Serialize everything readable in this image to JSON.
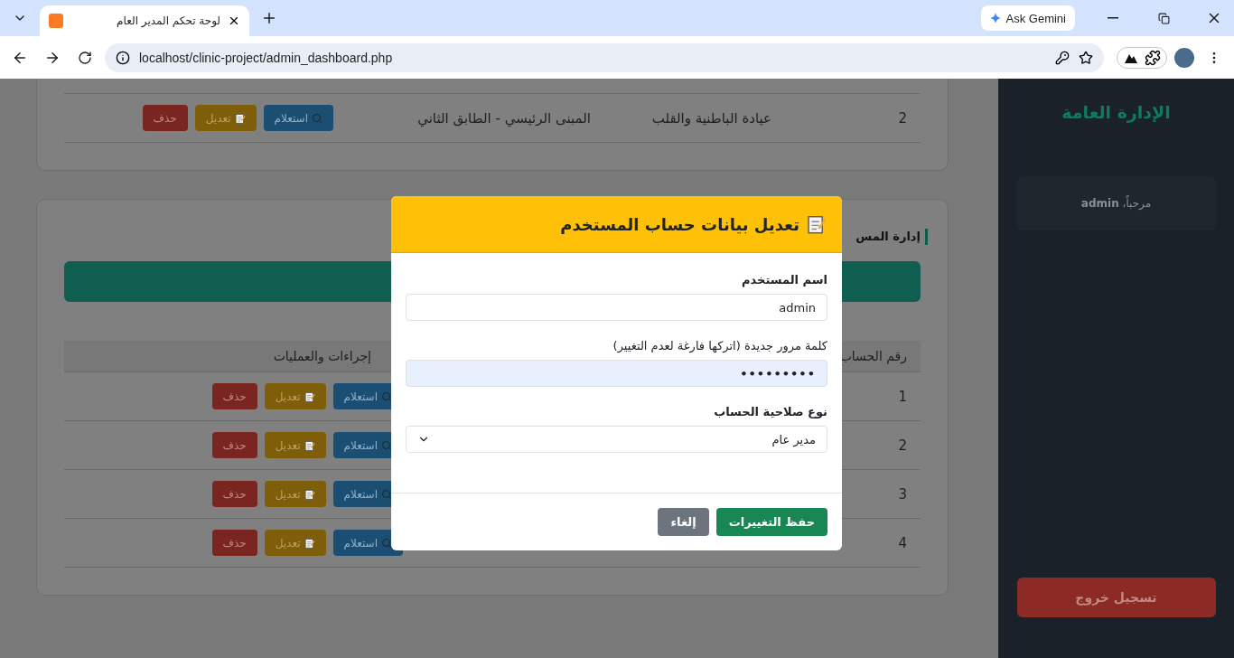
{
  "browser": {
    "tab_title": "لوحة تحكم المدير العام",
    "url": "localhost/clinic-project/admin_dashboard.php",
    "gemini_label": "Ask Gemini"
  },
  "locations_card": {
    "rows": [
      {
        "number": "2",
        "clinic": "عيادة الباطنية والقلب",
        "location": "المبنى الرئيسي - الطابق الثاني",
        "actions": [
          {
            "kind": "inquire",
            "label": "استعلام"
          },
          {
            "kind": "edit",
            "label": "تعديل"
          },
          {
            "kind": "delete",
            "label": "حذف"
          }
        ]
      }
    ]
  },
  "users_card": {
    "title": "إدارة المس",
    "columns": [
      "رقم الحساب",
      "إجراءات والعمليات"
    ],
    "rows": [
      {
        "number": "1",
        "actions": [
          {
            "kind": "inquire",
            "label": "استعلام"
          },
          {
            "kind": "edit",
            "label": "تعديل"
          },
          {
            "kind": "delete",
            "label": "حذف"
          }
        ]
      },
      {
        "number": "2",
        "actions": [
          {
            "kind": "inquire",
            "label": "استعلام"
          },
          {
            "kind": "edit",
            "label": "تعديل"
          },
          {
            "kind": "delete",
            "label": "حذف"
          }
        ]
      },
      {
        "number": "3",
        "actions": [
          {
            "kind": "inquire",
            "label": "استعلام"
          },
          {
            "kind": "edit",
            "label": "تعديل"
          },
          {
            "kind": "delete",
            "label": "حذف"
          }
        ]
      },
      {
        "number": "4",
        "actions": [
          {
            "kind": "inquire",
            "label": "استعلام"
          },
          {
            "kind": "edit",
            "label": "تعديل"
          },
          {
            "kind": "delete",
            "label": "حذف"
          }
        ]
      }
    ]
  },
  "sidebar": {
    "title": "الإدارة العامة",
    "welcome": "مرحباً، **admin**",
    "logout": "تسجيل خروج"
  },
  "modal": {
    "title": "تعديل بيانات حساب المستخدم",
    "fields": [
      {
        "kind": "text",
        "label": "اسم المستخدم",
        "value": "admin"
      },
      {
        "kind": "password",
        "label": "كلمة مرور جديدة (اتركها فارغة لعدم التغيير)",
        "value": "•••••••••"
      },
      {
        "kind": "select",
        "label": "نوع صلاحية الحساب",
        "value": "مدير عام"
      }
    ],
    "buttons": [
      {
        "kind": "primary",
        "label": "حفظ التغييرات"
      },
      {
        "kind": "secondary",
        "label": "إلغاء"
      }
    ]
  }
}
